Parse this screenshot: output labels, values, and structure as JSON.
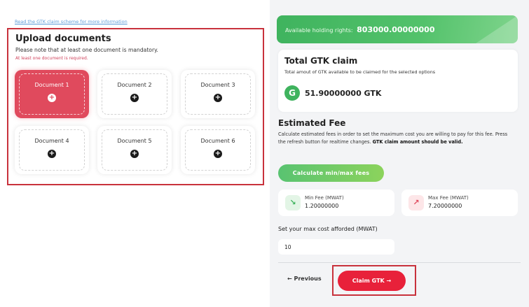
{
  "left": {
    "info_link": "Read the GTK claim scheme for more information",
    "upload": {
      "title": "Upload documents",
      "note": "Please note that at least one document is mandatory.",
      "required": "At least one document is required.",
      "documents": [
        {
          "label": "Document 1",
          "active": true
        },
        {
          "label": "Document 2",
          "active": false
        },
        {
          "label": "Document 3",
          "active": false
        },
        {
          "label": "Document 4",
          "active": false
        },
        {
          "label": "Document 5",
          "active": false
        },
        {
          "label": "Document 6",
          "active": false
        }
      ],
      "plus_glyph": "+"
    }
  },
  "right": {
    "holdings": {
      "label": "Available holding rights:",
      "value": "803000.00000000"
    },
    "gtk_claim": {
      "title": "Total GTK claim",
      "subtitle": "Total amout of GTK available to be claimed for the selected options",
      "logo_glyph": "G",
      "amount": "51.90000000 GTK"
    },
    "fee": {
      "title": "Estimated Fee",
      "description": "Calculate estimated fees in order to set the maximum cost you are willing to pay for this fee. Press the refresh button for realtime changes.",
      "description_bold": "GTK claim amount should be valid.",
      "calc_button": "Calculate min/max fees",
      "min": {
        "label": "Min Fee (MWAT)",
        "value": "1.20000000",
        "icon": "trend-down-icon"
      },
      "max": {
        "label": "Max Fee (MWAT)",
        "value": "7.20000000",
        "icon": "trend-up-icon"
      }
    },
    "max_cost": {
      "label": "Set your max cost afforded (MWAT)",
      "value": "10"
    },
    "footer": {
      "previous": "← Previous",
      "claim": "Claim GTK →"
    }
  },
  "colors": {
    "accent_red": "#e8213a",
    "highlight_red": "#c8323c",
    "green": "#3fb35e",
    "doc_active": "#e04a5d"
  }
}
